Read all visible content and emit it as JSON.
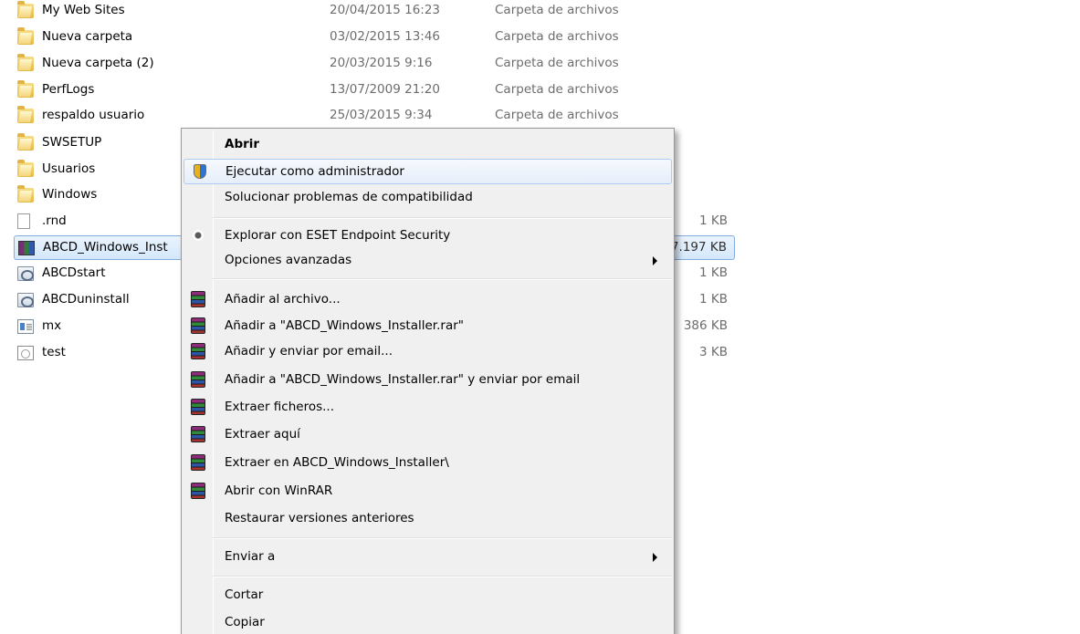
{
  "files": [
    {
      "name": "My Web Sites",
      "date": "20/04/2015 16:23",
      "type": "Carpeta de archivos",
      "size": "",
      "icon": "folder-icon"
    },
    {
      "name": "Nueva carpeta",
      "date": "03/02/2015 13:46",
      "type": "Carpeta de archivos",
      "size": "",
      "icon": "folder-icon"
    },
    {
      "name": "Nueva carpeta (2)",
      "date": "20/03/2015 9:16",
      "type": "Carpeta de archivos",
      "size": "",
      "icon": "folder-icon"
    },
    {
      "name": "PerfLogs",
      "date": "13/07/2009 21:20",
      "type": "Carpeta de archivos",
      "size": "",
      "icon": "folder-icon"
    },
    {
      "name": "respaldo usuario",
      "date": "25/03/2015 9:34",
      "type": "Carpeta de archivos",
      "size": "",
      "icon": "folder-icon"
    },
    {
      "name": "SWSETUP",
      "date": "",
      "type": "",
      "size": "",
      "icon": "folder-icon"
    },
    {
      "name": "Usuarios",
      "date": "",
      "type": "",
      "size": "",
      "icon": "folder-icon"
    },
    {
      "name": "Windows",
      "date": "",
      "type": "",
      "size": "",
      "icon": "folder-icon"
    },
    {
      "name": ".rnd",
      "date": "",
      "type": "",
      "size": "1 KB",
      "icon": "file-icon"
    },
    {
      "name": "ABCD_Windows_Inst",
      "date": "",
      "type": "",
      "size": "7.197 KB",
      "icon": "winrar-icon",
      "selected": true
    },
    {
      "name": "ABCDstart",
      "date": "",
      "type": "",
      "size": "1 KB",
      "icon": "shortcut-icon"
    },
    {
      "name": "ABCDuninstall",
      "date": "",
      "type": "",
      "size": "1 KB",
      "icon": "shortcut-icon"
    },
    {
      "name": "mx",
      "date": "",
      "type": "",
      "size": "386 KB",
      "icon": "mx-icon"
    },
    {
      "name": "test",
      "date": "",
      "type": "",
      "size": "3 KB",
      "icon": "test-icon"
    }
  ],
  "context_menu": {
    "items": [
      {
        "label": "Abrir",
        "bold": true
      },
      {
        "label": "Ejecutar como administrador",
        "icon": "shield-icon",
        "hover": true
      },
      {
        "label": "Solucionar problemas de compatibilidad"
      },
      {
        "label": "Explorar con ESET Endpoint Security",
        "icon": "eset-icon"
      },
      {
        "label": "Opciones avanzadas",
        "submenu": true
      },
      {
        "label": "Añadir al archivo...",
        "icon": "winrar-icon"
      },
      {
        "label": "Añadir a \"ABCD_Windows_Installer.rar\"",
        "icon": "winrar-icon"
      },
      {
        "label": "Añadir y enviar por email...",
        "icon": "winrar-icon"
      },
      {
        "label": "Añadir a \"ABCD_Windows_Installer.rar\" y enviar por email",
        "icon": "winrar-icon"
      },
      {
        "label": "Extraer ficheros...",
        "icon": "winrar-icon"
      },
      {
        "label": "Extraer aquí",
        "icon": "winrar-icon"
      },
      {
        "label": "Extraer en ABCD_Windows_Installer\\",
        "icon": "winrar-icon"
      },
      {
        "label": "Abrir con WinRAR",
        "icon": "winrar-icon"
      },
      {
        "label": "Restaurar versiones anteriores"
      },
      {
        "label": "Enviar a",
        "submenu": true
      },
      {
        "label": "Cortar"
      },
      {
        "label": "Copiar"
      }
    ]
  },
  "colors": {
    "selection_border": "#84acdd",
    "menu_background": "#f0f0f0",
    "menu_hover_border": "#aeccf0",
    "secondary_text": "#6d6d6d"
  }
}
